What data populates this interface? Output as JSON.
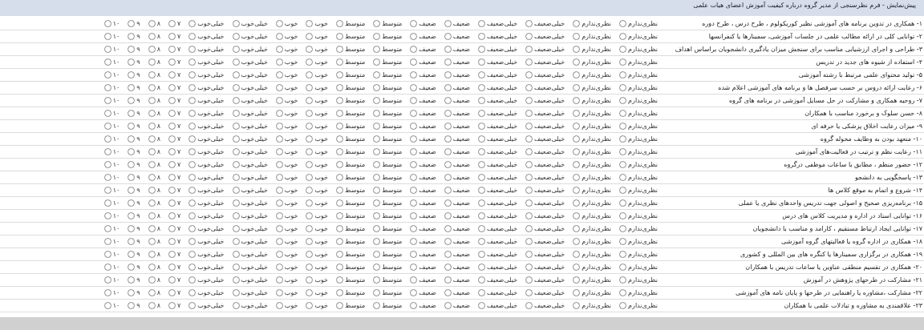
{
  "window": {
    "title": "پیش‌نمایش - فرم نظرسنجی از مدیر گروه درباره کیفیت آموزش اعضای هیات علمی"
  },
  "rows": [
    {
      "question": "۱- همکاری در تدوین برنامه های آموزشی نظیر کوریکولوم ، طرح درس ، طرح دوره",
      "options": [
        {
          "label": "نظری‌ندارم",
          "selected": false
        },
        {
          "label": "نظری‌ندارم",
          "selected": false
        },
        {
          "label": "خیلی‌ضعیف",
          "selected": false
        },
        {
          "label": "خیلی‌ضعیف",
          "selected": false
        },
        {
          "label": "ضعیف",
          "selected": false
        },
        {
          "label": "ضعیف",
          "selected": false
        },
        {
          "label": "متوسط",
          "selected": false
        },
        {
          "label": "متوسط",
          "selected": false
        },
        {
          "label": "خوب",
          "selected": false
        },
        {
          "label": "خوب",
          "selected": false
        },
        {
          "label": "خیلی‌خوب",
          "selected": false
        },
        {
          "label": "خیلی‌خوب",
          "selected": false
        },
        {
          "label": "۷",
          "selected": false
        },
        {
          "label": "۸",
          "selected": false
        },
        {
          "label": "۹",
          "selected": false
        },
        {
          "label": "۱۰",
          "selected": false
        }
      ]
    },
    {
      "question": "۲- توانایی کلی در ارائه مطالب علمی در جلسات آموزشی، سمینارها یا کنفرانسها",
      "options": [
        {
          "label": "نظری‌ندارم",
          "selected": false
        },
        {
          "label": "نظری‌ندارم",
          "selected": false
        },
        {
          "label": "خیلی‌ضعیف",
          "selected": false
        },
        {
          "label": "خیلی‌ضعیف",
          "selected": false
        },
        {
          "label": "ضعیف",
          "selected": false
        },
        {
          "label": "ضعیف",
          "selected": false
        },
        {
          "label": "متوسط",
          "selected": false
        },
        {
          "label": "متوسط",
          "selected": false
        },
        {
          "label": "خوب",
          "selected": false
        },
        {
          "label": "خوب",
          "selected": false
        },
        {
          "label": "خیلی‌خوب",
          "selected": false
        },
        {
          "label": "خیلی‌خوب",
          "selected": false
        },
        {
          "label": "۷",
          "selected": false
        },
        {
          "label": "۸",
          "selected": false
        },
        {
          "label": "۹",
          "selected": false
        },
        {
          "label": "۱۰",
          "selected": false
        }
      ]
    },
    {
      "question": "۳- طراحی و اجرای ارزشیابی مناسب برای سنجش میزان یادگیری دانشجویان براساس اهداف",
      "options": [
        {
          "label": "نظری‌ندارم",
          "selected": false
        },
        {
          "label": "نظری‌ندارم",
          "selected": false
        },
        {
          "label": "خیلی‌ضعیف",
          "selected": false
        },
        {
          "label": "خیلی‌ضعیف",
          "selected": false
        },
        {
          "label": "ضعیف",
          "selected": false
        },
        {
          "label": "ضعیف",
          "selected": false
        },
        {
          "label": "متوسط",
          "selected": false
        },
        {
          "label": "متوسط",
          "selected": false
        },
        {
          "label": "خوب",
          "selected": false
        },
        {
          "label": "خوب",
          "selected": false
        },
        {
          "label": "خیلی‌خوب",
          "selected": false
        },
        {
          "label": "خیلی‌خوب",
          "selected": false
        },
        {
          "label": "۷",
          "selected": false
        },
        {
          "label": "۸",
          "selected": false
        },
        {
          "label": "۹",
          "selected": false
        },
        {
          "label": "۱۰",
          "selected": false
        }
      ]
    },
    {
      "question": "۴- استفاده از شیوه های جدید در تدریس",
      "options": [
        {
          "label": "نظری‌ندارم",
          "selected": false
        },
        {
          "label": "نظری‌ندارم",
          "selected": false
        },
        {
          "label": "خیلی‌ضعیف",
          "selected": false
        },
        {
          "label": "خیلی‌ضعیف",
          "selected": false
        },
        {
          "label": "ضعیف",
          "selected": false
        },
        {
          "label": "ضعیف",
          "selected": false
        },
        {
          "label": "متوسط",
          "selected": false
        },
        {
          "label": "متوسط",
          "selected": false
        },
        {
          "label": "خوب",
          "selected": false
        },
        {
          "label": "خوب",
          "selected": false
        },
        {
          "label": "خیلی‌خوب",
          "selected": false
        },
        {
          "label": "خیلی‌خوب",
          "selected": false
        },
        {
          "label": "۷",
          "selected": false
        },
        {
          "label": "۸",
          "selected": false
        },
        {
          "label": "۹",
          "selected": false
        },
        {
          "label": "۱۰",
          "selected": false
        }
      ]
    },
    {
      "question": "۵- تولید محتوای علمی مرتبط با رشته آموزشی",
      "options": [
        {
          "label": "نظری‌ندارم",
          "selected": false
        },
        {
          "label": "نظری‌ندارم",
          "selected": false
        },
        {
          "label": "خیلی‌ضعیف",
          "selected": false
        },
        {
          "label": "خیلی‌ضعیف",
          "selected": false
        },
        {
          "label": "ضعیف",
          "selected": false
        },
        {
          "label": "ضعیف",
          "selected": false
        },
        {
          "label": "متوسط",
          "selected": false
        },
        {
          "label": "متوسط",
          "selected": false
        },
        {
          "label": "خوب",
          "selected": false
        },
        {
          "label": "خوب",
          "selected": false
        },
        {
          "label": "خیلی‌خوب",
          "selected": false
        },
        {
          "label": "خیلی‌خوب",
          "selected": false
        },
        {
          "label": "۷",
          "selected": false
        },
        {
          "label": "۸",
          "selected": false
        },
        {
          "label": "۹",
          "selected": false
        },
        {
          "label": "۱۰",
          "selected": false
        }
      ]
    },
    {
      "question": "۶- رعایت ارائه دروس بر حسب سرفصل ها و برنامه های آموزشی اعلام شده",
      "options": [
        {
          "label": "نظری‌ندارم",
          "selected": false
        },
        {
          "label": "نظری‌ندارم",
          "selected": false
        },
        {
          "label": "خیلی‌ضعیف",
          "selected": false
        },
        {
          "label": "خیلی‌ضعیف",
          "selected": false
        },
        {
          "label": "ضعیف",
          "selected": false
        },
        {
          "label": "ضعیف",
          "selected": false
        },
        {
          "label": "متوسط",
          "selected": false
        },
        {
          "label": "متوسط",
          "selected": false
        },
        {
          "label": "خوب",
          "selected": false
        },
        {
          "label": "خوب",
          "selected": false
        },
        {
          "label": "خیلی‌خوب",
          "selected": false
        },
        {
          "label": "خیلی‌خوب",
          "selected": false
        },
        {
          "label": "۷",
          "selected": false
        },
        {
          "label": "۸",
          "selected": false
        },
        {
          "label": "۹",
          "selected": false
        },
        {
          "label": "۱۰",
          "selected": false
        }
      ]
    },
    {
      "question": "۷- روحیه همکاری و مشارکت در حل مسایل آموزشی در برنامه های گروه",
      "options": [
        {
          "label": "نظری‌ندارم",
          "selected": false
        },
        {
          "label": "نظری‌ندارم",
          "selected": false
        },
        {
          "label": "خیلی‌ضعیف",
          "selected": false
        },
        {
          "label": "خیلی‌ضعیف",
          "selected": false
        },
        {
          "label": "ضعیف",
          "selected": false
        },
        {
          "label": "ضعیف",
          "selected": false
        },
        {
          "label": "متوسط",
          "selected": false
        },
        {
          "label": "متوسط",
          "selected": false
        },
        {
          "label": "خوب",
          "selected": false
        },
        {
          "label": "خوب",
          "selected": false
        },
        {
          "label": "خیلی‌خوب",
          "selected": false
        },
        {
          "label": "خیلی‌خوب",
          "selected": false
        },
        {
          "label": "۷",
          "selected": false
        },
        {
          "label": "۸",
          "selected": false
        },
        {
          "label": "۹",
          "selected": false
        },
        {
          "label": "۱۰",
          "selected": false
        }
      ]
    },
    {
      "question": "۸- حسن سلوک و برخورد مناسب با همکاران",
      "options": [
        {
          "label": "نظری‌ندارم",
          "selected": false
        },
        {
          "label": "نظری‌ندارم",
          "selected": false
        },
        {
          "label": "خیلی‌ضعیف",
          "selected": false
        },
        {
          "label": "خیلی‌ضعیف",
          "selected": false
        },
        {
          "label": "ضعیف",
          "selected": false
        },
        {
          "label": "ضعیف",
          "selected": false
        },
        {
          "label": "متوسط",
          "selected": false
        },
        {
          "label": "متوسط",
          "selected": false
        },
        {
          "label": "خوب",
          "selected": false
        },
        {
          "label": "خوب",
          "selected": false
        },
        {
          "label": "خیلی‌خوب",
          "selected": false
        },
        {
          "label": "خیلی‌خوب",
          "selected": false
        },
        {
          "label": "۷",
          "selected": false
        },
        {
          "label": "۸",
          "selected": false
        },
        {
          "label": "۹",
          "selected": false
        },
        {
          "label": "۱۰",
          "selected": false
        }
      ]
    },
    {
      "question": "۹- میزان رعایت اخلاق پزشکی یا حرفه ای",
      "options": [
        {
          "label": "نظری‌ندارم",
          "selected": false
        },
        {
          "label": "نظری‌ندارم",
          "selected": false
        },
        {
          "label": "خیلی‌ضعیف",
          "selected": false
        },
        {
          "label": "خیلی‌ضعیف",
          "selected": false
        },
        {
          "label": "ضعیف",
          "selected": false
        },
        {
          "label": "ضعیف",
          "selected": false
        },
        {
          "label": "متوسط",
          "selected": false
        },
        {
          "label": "متوسط",
          "selected": false
        },
        {
          "label": "خوب",
          "selected": false
        },
        {
          "label": "خوب",
          "selected": false
        },
        {
          "label": "خیلی‌خوب",
          "selected": false
        },
        {
          "label": "خیلی‌خوب",
          "selected": false
        },
        {
          "label": "۷",
          "selected": false
        },
        {
          "label": "۸",
          "selected": false
        },
        {
          "label": "۹",
          "selected": false
        },
        {
          "label": "۱۰",
          "selected": false
        }
      ]
    },
    {
      "question": "۱۰- متعهد بودن به وظایف محوله گروه",
      "options": [
        {
          "label": "نظری‌ندارم",
          "selected": false
        },
        {
          "label": "نظری‌ندارم",
          "selected": false
        },
        {
          "label": "خیلی‌ضعیف",
          "selected": false
        },
        {
          "label": "خیلی‌ضعیف",
          "selected": false
        },
        {
          "label": "ضعیف",
          "selected": false
        },
        {
          "label": "ضعیف",
          "selected": false
        },
        {
          "label": "متوسط",
          "selected": false
        },
        {
          "label": "متوسط",
          "selected": false
        },
        {
          "label": "خوب",
          "selected": false
        },
        {
          "label": "خوب",
          "selected": false
        },
        {
          "label": "خیلی‌خوب",
          "selected": false
        },
        {
          "label": "خیلی‌خوب",
          "selected": false
        },
        {
          "label": "۷",
          "selected": false
        },
        {
          "label": "۸",
          "selected": false
        },
        {
          "label": "۹",
          "selected": false
        },
        {
          "label": "۱۰",
          "selected": false
        }
      ]
    },
    {
      "question": "۱۱- رعایت نظم و ترتیب در فعالیت‌های آموزشی",
      "options": [
        {
          "label": "نظری‌ندارم",
          "selected": false
        },
        {
          "label": "نظری‌ندارم",
          "selected": false
        },
        {
          "label": "خیلی‌ضعیف",
          "selected": false
        },
        {
          "label": "خیلی‌ضعیف",
          "selected": false
        },
        {
          "label": "ضعیف",
          "selected": false
        },
        {
          "label": "ضعیف",
          "selected": false
        },
        {
          "label": "متوسط",
          "selected": false
        },
        {
          "label": "متوسط",
          "selected": false
        },
        {
          "label": "خوب",
          "selected": false
        },
        {
          "label": "خوب",
          "selected": false
        },
        {
          "label": "خیلی‌خوب",
          "selected": false
        },
        {
          "label": "خیلی‌خوب",
          "selected": false
        },
        {
          "label": "۷",
          "selected": false
        },
        {
          "label": "۸",
          "selected": false
        },
        {
          "label": "۹",
          "selected": false
        },
        {
          "label": "۱۰",
          "selected": false
        }
      ]
    },
    {
      "question": "۱۲- حضور منظم ، مطابق با ساعات موظفی درگروه",
      "options": [
        {
          "label": "نظری‌ندارم",
          "selected": false
        },
        {
          "label": "نظری‌ندارم",
          "selected": false
        },
        {
          "label": "خیلی‌ضعیف",
          "selected": false
        },
        {
          "label": "خیلی‌ضعیف",
          "selected": false
        },
        {
          "label": "ضعیف",
          "selected": false
        },
        {
          "label": "ضعیف",
          "selected": false
        },
        {
          "label": "متوسط",
          "selected": false
        },
        {
          "label": "متوسط",
          "selected": false
        },
        {
          "label": "خوب",
          "selected": false
        },
        {
          "label": "خوب",
          "selected": false
        },
        {
          "label": "خیلی‌خوب",
          "selected": false
        },
        {
          "label": "خیلی‌خوب",
          "selected": false
        },
        {
          "label": "۷",
          "selected": false
        },
        {
          "label": "۸",
          "selected": false
        },
        {
          "label": "۹",
          "selected": false
        },
        {
          "label": "۱۰",
          "selected": false
        }
      ]
    },
    {
      "question": "۱۳- پاسخگویی به دانشجو",
      "options": [
        {
          "label": "نظری‌ندارم",
          "selected": false
        },
        {
          "label": "نظری‌ندارم",
          "selected": false
        },
        {
          "label": "خیلی‌ضعیف",
          "selected": false
        },
        {
          "label": "خیلی‌ضعیف",
          "selected": false
        },
        {
          "label": "ضعیف",
          "selected": false
        },
        {
          "label": "ضعیف",
          "selected": false
        },
        {
          "label": "متوسط",
          "selected": false
        },
        {
          "label": "متوسط",
          "selected": false
        },
        {
          "label": "خوب",
          "selected": false
        },
        {
          "label": "خوب",
          "selected": false
        },
        {
          "label": "خیلی‌خوب",
          "selected": false
        },
        {
          "label": "خیلی‌خوب",
          "selected": false
        },
        {
          "label": "۷",
          "selected": false
        },
        {
          "label": "۸",
          "selected": false
        },
        {
          "label": "۹",
          "selected": false
        },
        {
          "label": "۱۰",
          "selected": false
        }
      ]
    },
    {
      "question": "۱۴- شروع و اتمام به موقع کلاس ها",
      "options": [
        {
          "label": "نظری‌ندارم",
          "selected": false
        },
        {
          "label": "نظری‌ندارم",
          "selected": false
        },
        {
          "label": "خیلی‌ضعیف",
          "selected": false
        },
        {
          "label": "خیلی‌ضعیف",
          "selected": false
        },
        {
          "label": "ضعیف",
          "selected": false
        },
        {
          "label": "ضعیف",
          "selected": false
        },
        {
          "label": "متوسط",
          "selected": false
        },
        {
          "label": "متوسط",
          "selected": false
        },
        {
          "label": "خوب",
          "selected": false
        },
        {
          "label": "خوب",
          "selected": false
        },
        {
          "label": "خیلی‌خوب",
          "selected": false
        },
        {
          "label": "خیلی‌خوب",
          "selected": false
        },
        {
          "label": "۷",
          "selected": false
        },
        {
          "label": "۸",
          "selected": false
        },
        {
          "label": "۹",
          "selected": false
        },
        {
          "label": "۱۰",
          "selected": false
        }
      ]
    },
    {
      "question": "۱۵- برنامه‌ریزی صحیح و اصولی جهت تدریس واحدهای نظری یا عملی",
      "options": [
        {
          "label": "نظری‌ندارم",
          "selected": false
        },
        {
          "label": "نظری‌ندارم",
          "selected": false
        },
        {
          "label": "خیلی‌ضعیف",
          "selected": false
        },
        {
          "label": "خیلی‌ضعیف",
          "selected": false
        },
        {
          "label": "ضعیف",
          "selected": false
        },
        {
          "label": "ضعیف",
          "selected": false
        },
        {
          "label": "متوسط",
          "selected": false
        },
        {
          "label": "متوسط",
          "selected": false
        },
        {
          "label": "خوب",
          "selected": false
        },
        {
          "label": "خوب",
          "selected": false
        },
        {
          "label": "خیلی‌خوب",
          "selected": false
        },
        {
          "label": "خیلی‌خوب",
          "selected": false
        },
        {
          "label": "۷",
          "selected": false
        },
        {
          "label": "۸",
          "selected": false
        },
        {
          "label": "۹",
          "selected": false
        },
        {
          "label": "۱۰",
          "selected": false
        }
      ]
    },
    {
      "question": "۱۶- توانایی استاد در اداره و مدیریت کلاس های درس",
      "options": [
        {
          "label": "نظری‌ندارم",
          "selected": false
        },
        {
          "label": "نظری‌ندارم",
          "selected": false
        },
        {
          "label": "خیلی‌ضعیف",
          "selected": false
        },
        {
          "label": "خیلی‌ضعیف",
          "selected": false
        },
        {
          "label": "ضعیف",
          "selected": false
        },
        {
          "label": "ضعیف",
          "selected": false
        },
        {
          "label": "متوسط",
          "selected": false
        },
        {
          "label": "متوسط",
          "selected": false
        },
        {
          "label": "خوب",
          "selected": false
        },
        {
          "label": "خوب",
          "selected": false
        },
        {
          "label": "خیلی‌خوب",
          "selected": false
        },
        {
          "label": "خیلی‌خوب",
          "selected": false
        },
        {
          "label": "۷",
          "selected": false
        },
        {
          "label": "۸",
          "selected": false
        },
        {
          "label": "۹",
          "selected": false
        },
        {
          "label": "۱۰",
          "selected": false
        }
      ]
    },
    {
      "question": "۱۷- توانایی ایجاد ارتباط مستقیم ، کارامد و مناسب با دانشجویان",
      "options": [
        {
          "label": "نظری‌ندارم",
          "selected": false
        },
        {
          "label": "نظری‌ندارم",
          "selected": false
        },
        {
          "label": "خیلی‌ضعیف",
          "selected": false
        },
        {
          "label": "خیلی‌ضعیف",
          "selected": false
        },
        {
          "label": "ضعیف",
          "selected": false
        },
        {
          "label": "ضعیف",
          "selected": false
        },
        {
          "label": "متوسط",
          "selected": false
        },
        {
          "label": "متوسط",
          "selected": false
        },
        {
          "label": "خوب",
          "selected": false
        },
        {
          "label": "خوب",
          "selected": false
        },
        {
          "label": "خیلی‌خوب",
          "selected": false
        },
        {
          "label": "خیلی‌خوب",
          "selected": false
        },
        {
          "label": "۷",
          "selected": false
        },
        {
          "label": "۸",
          "selected": false
        },
        {
          "label": "۹",
          "selected": false
        },
        {
          "label": "۱۰",
          "selected": false
        }
      ]
    },
    {
      "question": "۱۸- همکاری در اداره گروه یا فعالیتهای گروه آموزشی",
      "options": [
        {
          "label": "نظری‌ندارم",
          "selected": false
        },
        {
          "label": "نظری‌ندارم",
          "selected": false
        },
        {
          "label": "خیلی‌ضعیف",
          "selected": false
        },
        {
          "label": "خیلی‌ضعیف",
          "selected": false
        },
        {
          "label": "ضعیف",
          "selected": false
        },
        {
          "label": "ضعیف",
          "selected": false
        },
        {
          "label": "متوسط",
          "selected": false
        },
        {
          "label": "متوسط",
          "selected": false
        },
        {
          "label": "خوب",
          "selected": false
        },
        {
          "label": "خوب",
          "selected": false
        },
        {
          "label": "خیلی‌خوب",
          "selected": false
        },
        {
          "label": "خیلی‌خوب",
          "selected": false
        },
        {
          "label": "۷",
          "selected": false
        },
        {
          "label": "۸",
          "selected": false
        },
        {
          "label": "۹",
          "selected": false
        },
        {
          "label": "۱۰",
          "selected": false
        }
      ]
    },
    {
      "question": "۱۹- همکاری در برگزاری سمینارها یا کنگره های بین المللی و کشوری",
      "options": [
        {
          "label": "نظری‌ندارم",
          "selected": false
        },
        {
          "label": "نظری‌ندارم",
          "selected": false
        },
        {
          "label": "خیلی‌ضعیف",
          "selected": false
        },
        {
          "label": "خیلی‌ضعیف",
          "selected": false
        },
        {
          "label": "ضعیف",
          "selected": false
        },
        {
          "label": "ضعیف",
          "selected": false
        },
        {
          "label": "متوسط",
          "selected": false
        },
        {
          "label": "متوسط",
          "selected": false
        },
        {
          "label": "خوب",
          "selected": false
        },
        {
          "label": "خوب",
          "selected": false
        },
        {
          "label": "خیلی‌خوب",
          "selected": false
        },
        {
          "label": "خیلی‌خوب",
          "selected": false
        },
        {
          "label": "۷",
          "selected": false
        },
        {
          "label": "۸",
          "selected": false
        },
        {
          "label": "۹",
          "selected": false
        },
        {
          "label": "۱۰",
          "selected": false
        }
      ]
    },
    {
      "question": "۲۰- همکاری در تقسیم منطقی عناوین یا ساعات تدریس با همکاران",
      "options": [
        {
          "label": "نظری‌ندارم",
          "selected": false
        },
        {
          "label": "نظری‌ندارم",
          "selected": false
        },
        {
          "label": "خیلی‌ضعیف",
          "selected": false
        },
        {
          "label": "خیلی‌ضعیف",
          "selected": false
        },
        {
          "label": "ضعیف",
          "selected": false
        },
        {
          "label": "ضعیف",
          "selected": false
        },
        {
          "label": "متوسط",
          "selected": false
        },
        {
          "label": "متوسط",
          "selected": false
        },
        {
          "label": "خوب",
          "selected": false
        },
        {
          "label": "خوب",
          "selected": false
        },
        {
          "label": "خیلی‌خوب",
          "selected": false
        },
        {
          "label": "خیلی‌خوب",
          "selected": false
        },
        {
          "label": "۷",
          "selected": false
        },
        {
          "label": "۸",
          "selected": false
        },
        {
          "label": "۹",
          "selected": false
        },
        {
          "label": "۱۰",
          "selected": false
        }
      ]
    },
    {
      "question": "۲۱- مشارکت در طرحهای پژوهش در آموزش",
      "options": [
        {
          "label": "نظری‌ندارم",
          "selected": false
        },
        {
          "label": "نظری‌ندارم",
          "selected": false
        },
        {
          "label": "خیلی‌ضعیف",
          "selected": false
        },
        {
          "label": "خیلی‌ضعیف",
          "selected": false
        },
        {
          "label": "ضعیف",
          "selected": false
        },
        {
          "label": "ضعیف",
          "selected": false
        },
        {
          "label": "متوسط",
          "selected": false
        },
        {
          "label": "متوسط",
          "selected": false
        },
        {
          "label": "خوب",
          "selected": false
        },
        {
          "label": "خوب",
          "selected": false
        },
        {
          "label": "خیلی‌خوب",
          "selected": false
        },
        {
          "label": "خیلی‌خوب",
          "selected": false
        },
        {
          "label": "۷",
          "selected": false
        },
        {
          "label": "۸",
          "selected": false
        },
        {
          "label": "۹",
          "selected": false
        },
        {
          "label": "۱۰",
          "selected": false
        }
      ]
    },
    {
      "question": "۲۲- مشارکت ،مشاوره یا راهنمایی در طرحها و پایان نامه های آموزشی",
      "options": [
        {
          "label": "نظری‌ندارم",
          "selected": false
        },
        {
          "label": "نظری‌ندارم",
          "selected": false
        },
        {
          "label": "خیلی‌ضعیف",
          "selected": false
        },
        {
          "label": "خیلی‌ضعیف",
          "selected": false
        },
        {
          "label": "ضعیف",
          "selected": false
        },
        {
          "label": "ضعیف",
          "selected": false
        },
        {
          "label": "متوسط",
          "selected": false
        },
        {
          "label": "متوسط",
          "selected": false
        },
        {
          "label": "خوب",
          "selected": false
        },
        {
          "label": "خوب",
          "selected": false
        },
        {
          "label": "خیلی‌خوب",
          "selected": false
        },
        {
          "label": "خیلی‌خوب",
          "selected": false
        },
        {
          "label": "۷",
          "selected": false
        },
        {
          "label": "۸",
          "selected": false
        },
        {
          "label": "۹",
          "selected": false
        },
        {
          "label": "۱۰",
          "selected": false
        }
      ]
    },
    {
      "question": "۲۳- علاقمندی به مشاوره و تبادلات علمی با همکاران",
      "options": [
        {
          "label": "نظری‌ندارم",
          "selected": false
        },
        {
          "label": "نظری‌ندارم",
          "selected": false
        },
        {
          "label": "خیلی‌ضعیف",
          "selected": false
        },
        {
          "label": "خیلی‌ضعیف",
          "selected": false
        },
        {
          "label": "ضعیف",
          "selected": false
        },
        {
          "label": "ضعیف",
          "selected": false
        },
        {
          "label": "متوسط",
          "selected": false
        },
        {
          "label": "متوسط",
          "selected": false
        },
        {
          "label": "خوب",
          "selected": false
        },
        {
          "label": "خوب",
          "selected": false
        },
        {
          "label": "خیلی‌خوب",
          "selected": false
        },
        {
          "label": "خیلی‌خوب",
          "selected": false
        },
        {
          "label": "۷",
          "selected": false
        },
        {
          "label": "۸",
          "selected": false
        },
        {
          "label": "۹",
          "selected": false
        },
        {
          "label": "۱۰",
          "selected": false
        }
      ]
    }
  ]
}
